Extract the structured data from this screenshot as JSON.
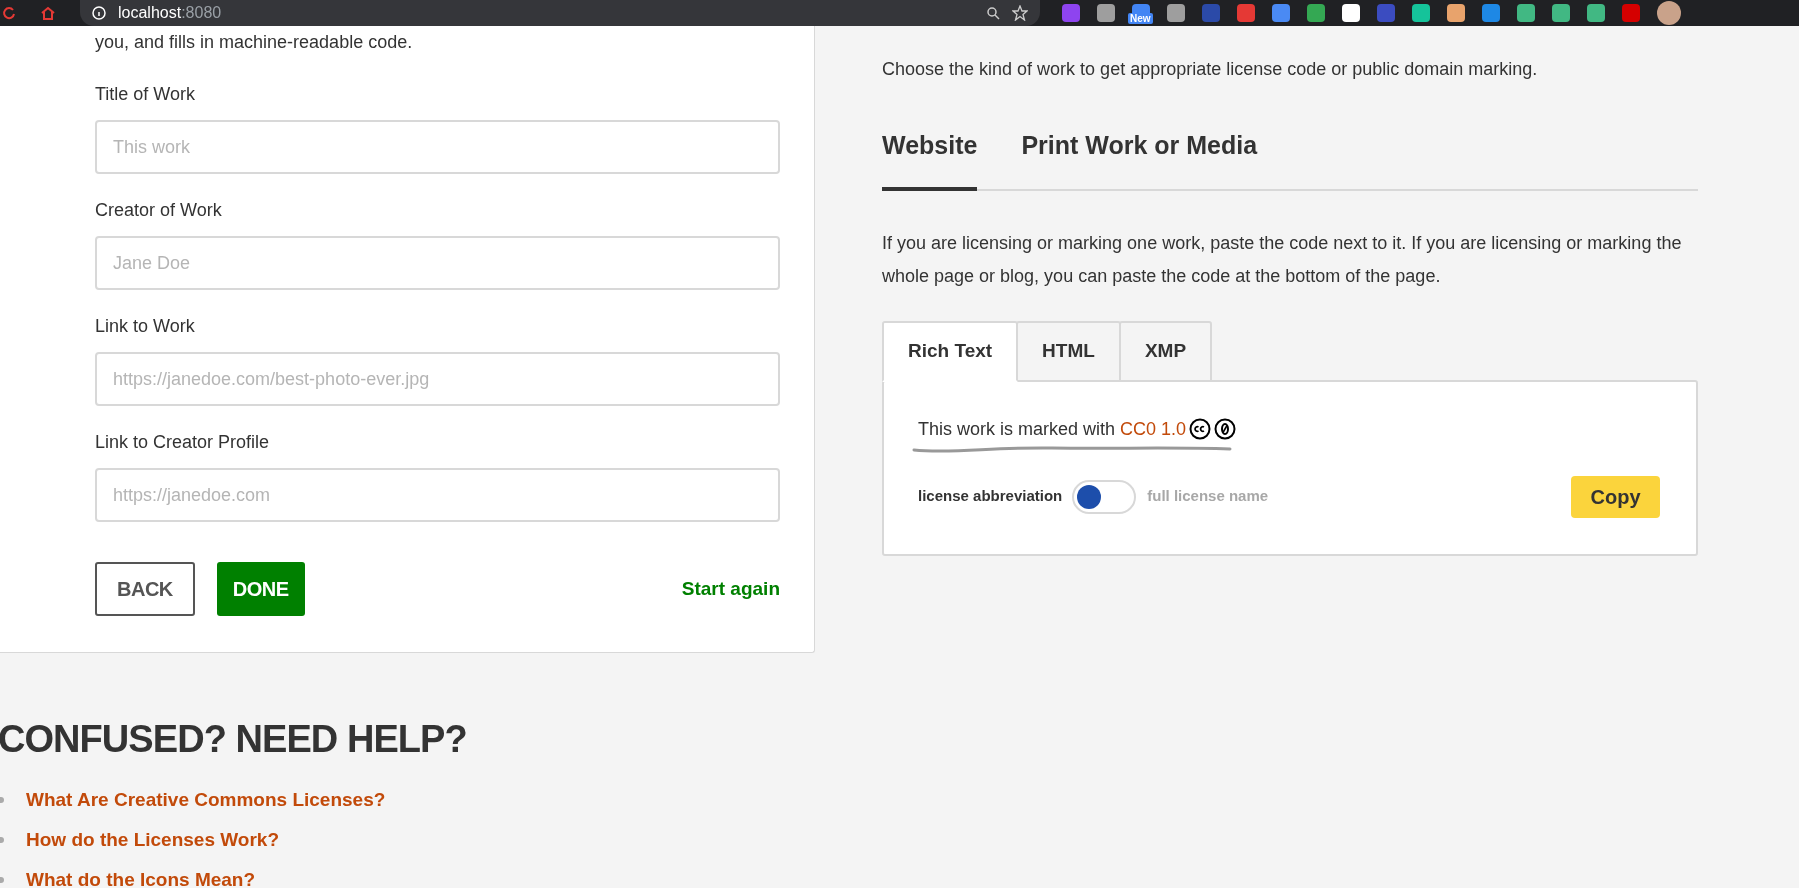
{
  "browser": {
    "host": "localhost",
    "port": ":8080",
    "extensions": [
      {
        "color": "#8e44ef"
      },
      {
        "color": "#9e9e9e"
      },
      {
        "color": "#4285f4",
        "badge": "New"
      },
      {
        "color": "#9e9e9e"
      },
      {
        "color": "#2b4aa8"
      },
      {
        "color": "#e53935"
      },
      {
        "color": "#4a8af4"
      },
      {
        "color": "#34a853"
      },
      {
        "color": "#ffffff"
      },
      {
        "color": "#3b4cc0"
      },
      {
        "color": "#15c39a"
      },
      {
        "color": "#e8a36c"
      },
      {
        "color": "#1e88e5"
      },
      {
        "color": "#41b883"
      },
      {
        "color": "#41b883"
      },
      {
        "color": "#41b883"
      },
      {
        "color": "#d50000"
      }
    ]
  },
  "form": {
    "intro": "you, and fills in machine-readable code.",
    "fields": [
      {
        "label": "Title of Work",
        "placeholder": "This work"
      },
      {
        "label": "Creator of Work",
        "placeholder": "Jane Doe"
      },
      {
        "label": "Link to Work",
        "placeholder": "https://janedoe.com/best-photo-ever.jpg"
      },
      {
        "label": "Link to Creator Profile",
        "placeholder": "https://janedoe.com"
      }
    ],
    "back": "BACK",
    "done": "DONE",
    "start_again": "Start again"
  },
  "mark": {
    "description": "Choose the kind of work to get appropriate license code or public domain marking.",
    "tabs": [
      {
        "label": "Website",
        "selected": true
      },
      {
        "label": "Print Work or Media",
        "selected": false
      }
    ],
    "instructions": "If you are licensing or marking one work, paste the code next to it. If you are licensing or marking the whole page or blog, you can paste the code at the bottom of the page.",
    "code_tabs": [
      {
        "label": "Rich Text",
        "selected": true
      },
      {
        "label": "HTML",
        "selected": false
      },
      {
        "label": "XMP",
        "selected": false
      }
    ],
    "attribution": {
      "text": "This work is marked with ",
      "link": "CC0 1.0"
    },
    "toggle": {
      "left_label": "license abbreviation",
      "right_label": "full license name",
      "on": false
    },
    "copy": "Copy"
  },
  "help": {
    "heading": "CONFUSED? NEED HELP?",
    "links": [
      "What Are Creative Commons Licenses?",
      "How do the Licenses Work?",
      "What do the Icons Mean?"
    ]
  }
}
